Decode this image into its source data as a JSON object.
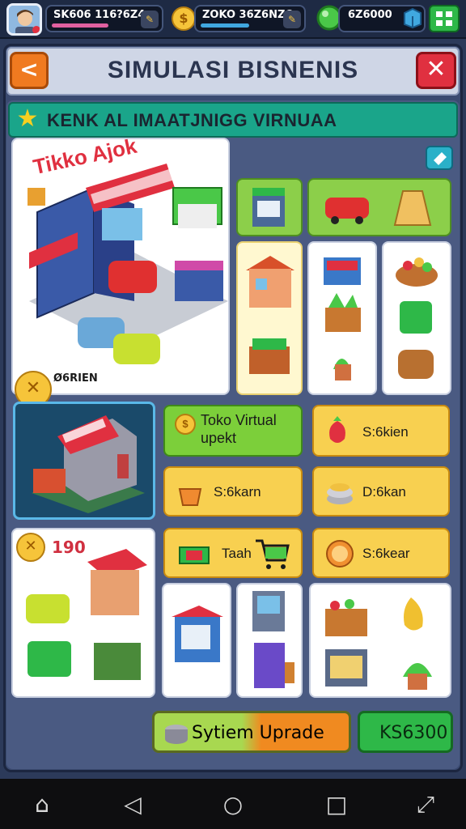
{
  "topbar": {
    "player_name": "SK606 116?6Z4",
    "coins": "ZOKO 36Z6NZO",
    "gems": "6Z6000"
  },
  "header": {
    "title": "SIMULASI BISNENIS",
    "back_icon": "<",
    "close_icon": "✕"
  },
  "section": {
    "subtitle": "KENK AL IMAATJNIGG VIRNUAA"
  },
  "shop_scene": {
    "sign_text": "Tikko Ajok",
    "badge_text": "Ø6RIEN"
  },
  "actions": {
    "toko_virtual": "Toko Virtual upekt",
    "item1": "S:6kien",
    "item2": "S:6karn",
    "item3": "D:6kan",
    "item4": "Taah",
    "item5": "S:6kear",
    "level_value": "190"
  },
  "footer": {
    "system_upgrade": "Sytiem Uprade",
    "price": "KS6300"
  },
  "colors": {
    "accent_teal": "#1aa58a",
    "green": "#7ccf3a",
    "yellow": "#f8d050",
    "orange": "#f07a20",
    "red": "#e03040"
  }
}
